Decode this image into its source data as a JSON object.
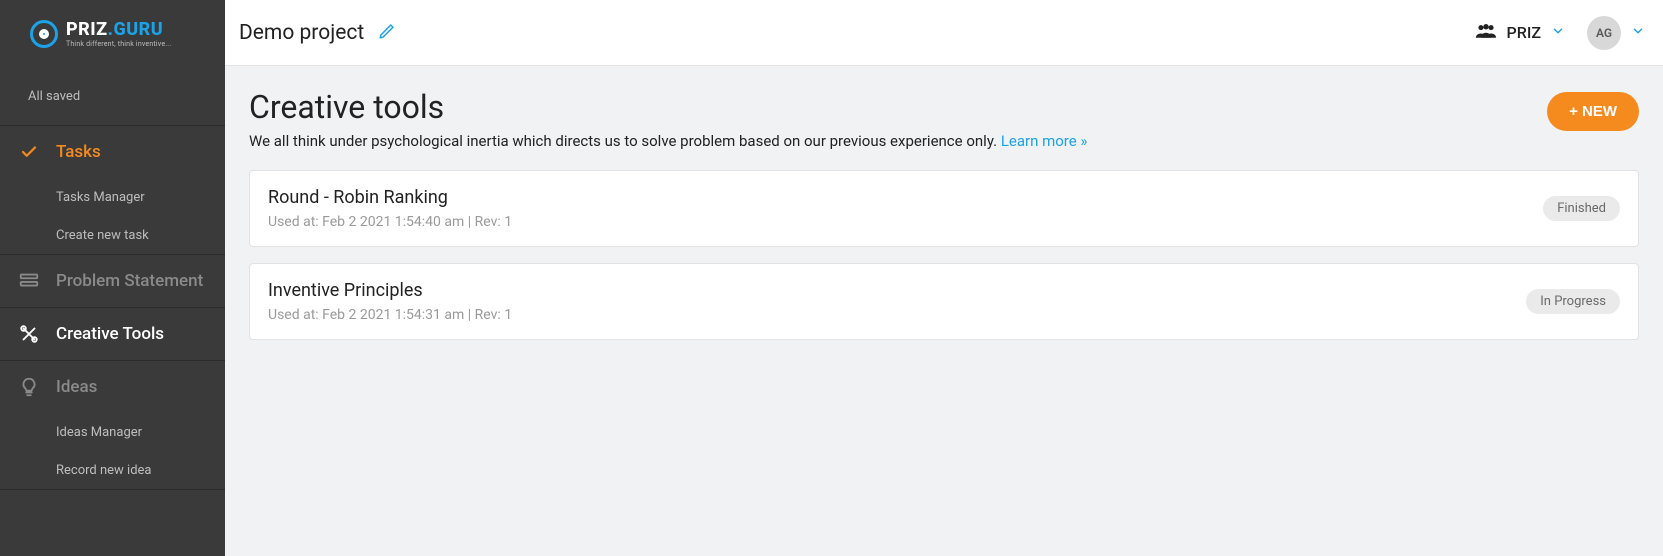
{
  "logo": {
    "brand_left": "PRIZ",
    "brand_right": ".GURU",
    "tagline": "Think different, think inventive..."
  },
  "sidebar": {
    "status": "All saved",
    "tasks": {
      "label": "Tasks",
      "sub1": "Tasks Manager",
      "sub2": "Create new task"
    },
    "problem": {
      "label": "Problem Statement"
    },
    "tools": {
      "label": "Creative Tools"
    },
    "ideas": {
      "label": "Ideas",
      "sub1": "Ideas Manager",
      "sub2": "Record new idea"
    }
  },
  "topbar": {
    "project": "Demo project",
    "team": "PRIZ",
    "avatar": "AG"
  },
  "page": {
    "title": "Creative tools",
    "subtitle": "We all think under psychological inertia which directs us to solve problem based on our previous experience only. ",
    "learn": "Learn more »",
    "new_button": "+ NEW"
  },
  "items": [
    {
      "title": "Round - Robin Ranking",
      "meta": "Used at: Feb 2 2021 1:54:40 am | Rev: 1",
      "status": "Finished"
    },
    {
      "title": "Inventive Principles",
      "meta": "Used at: Feb 2 2021 1:54:31 am | Rev: 1",
      "status": "In Progress"
    }
  ]
}
